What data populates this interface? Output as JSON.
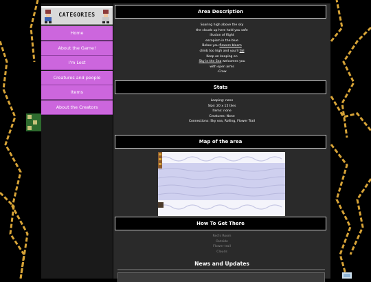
{
  "sidebar": {
    "header_title": "CATEGORIES",
    "items": [
      {
        "label": "Home"
      },
      {
        "label": "About the Game!"
      },
      {
        "label": "I'm Lost"
      },
      {
        "label": "Creatures and people"
      },
      {
        "label": "Items"
      },
      {
        "label": "About the Creators"
      }
    ]
  },
  "area_description": {
    "title": "Area Description",
    "lines": [
      "Soaring high above the sky",
      "the clouds up here hold you safe",
      "illusion of flight",
      "escapism in the blue",
      "Below you ",
      "climb too high and you'll ",
      "Keep on keeping on",
      " welcomes you",
      "with open arms",
      "-Crow"
    ],
    "link_flowers": "flowers bloom",
    "link_fall": "fall",
    "link_sky": "Sky in the Sea"
  },
  "stats": {
    "title": "Stats",
    "lines": [
      "Looping: none",
      "Size: 20 x 15 tiles",
      "Items: none",
      "Creatures: None",
      "Connections: Sky sea, Rolling, Flower Trail"
    ]
  },
  "map": {
    "title": "Map of the area"
  },
  "how_to": {
    "title": "How To Get There",
    "steps": [
      "Red's Room",
      "Outside",
      "Flower trail",
      "Clouds"
    ]
  },
  "news": {
    "title": "News and Updates"
  },
  "colors": {
    "nav": "#cc66dd",
    "panel": "#2a2a2a",
    "sidebar": "#1a1a1a",
    "wire": "#d8a437"
  }
}
